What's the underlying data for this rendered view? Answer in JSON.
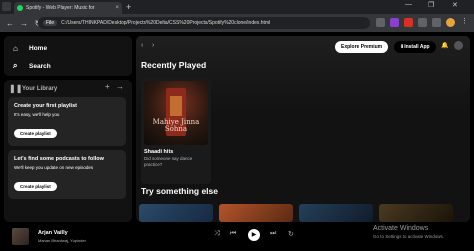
{
  "browser": {
    "tab_title": "Spotify - Web Player: Music for",
    "tab_close": "×",
    "new_tab": "+",
    "address_chip": "File",
    "address": "C:/Users/THINKPAD/Desktop/Projects%20Delta/CSS%20Projects/Spotify%20clone/index.html",
    "back": "←",
    "forward": "→",
    "reload": "↻",
    "minimize": "—",
    "maximize": "❐",
    "close": "✕"
  },
  "nav": {
    "home": "Home",
    "search": "Search",
    "home_icon": "⌂",
    "search_icon": "⌕"
  },
  "library": {
    "title": "Your Library",
    "icon": "❚❚",
    "add": "+",
    "expand": "→",
    "playlist_card": {
      "title": "Create your first playlist",
      "subtitle": "It's easy, we'll help you",
      "button": "Create playlist"
    },
    "podcast_card": {
      "title": "Let's find some podcasts to follow",
      "subtitle": "We'll keep you update on new episodes",
      "button": "Create playlist"
    }
  },
  "main": {
    "back": "‹",
    "forward": "›",
    "explore": "Explore Premium",
    "install": "⬇Install App",
    "bell": "🔔",
    "recently_played": "Recently Played",
    "album": {
      "cover_text": "Mahiye Jinna Sohna",
      "title": "Shaadi hits",
      "subtitle": "Did someone say dance practice?"
    },
    "try_something_else": "Try something else"
  },
  "player": {
    "title": "Arjan Vailly",
    "artist": "Manan Bhardwaj, Yupinder",
    "shuffle": "⤨",
    "prev": "⏮",
    "play": "▶",
    "next": "⏭",
    "repeat": "↻",
    "activate_title": "Activate Windows",
    "activate_sub": "Go to Settings to activate Windows."
  },
  "colors": {
    "accent": "#1ed760",
    "background": "#000000",
    "panel": "#121212",
    "card": "#242424"
  }
}
